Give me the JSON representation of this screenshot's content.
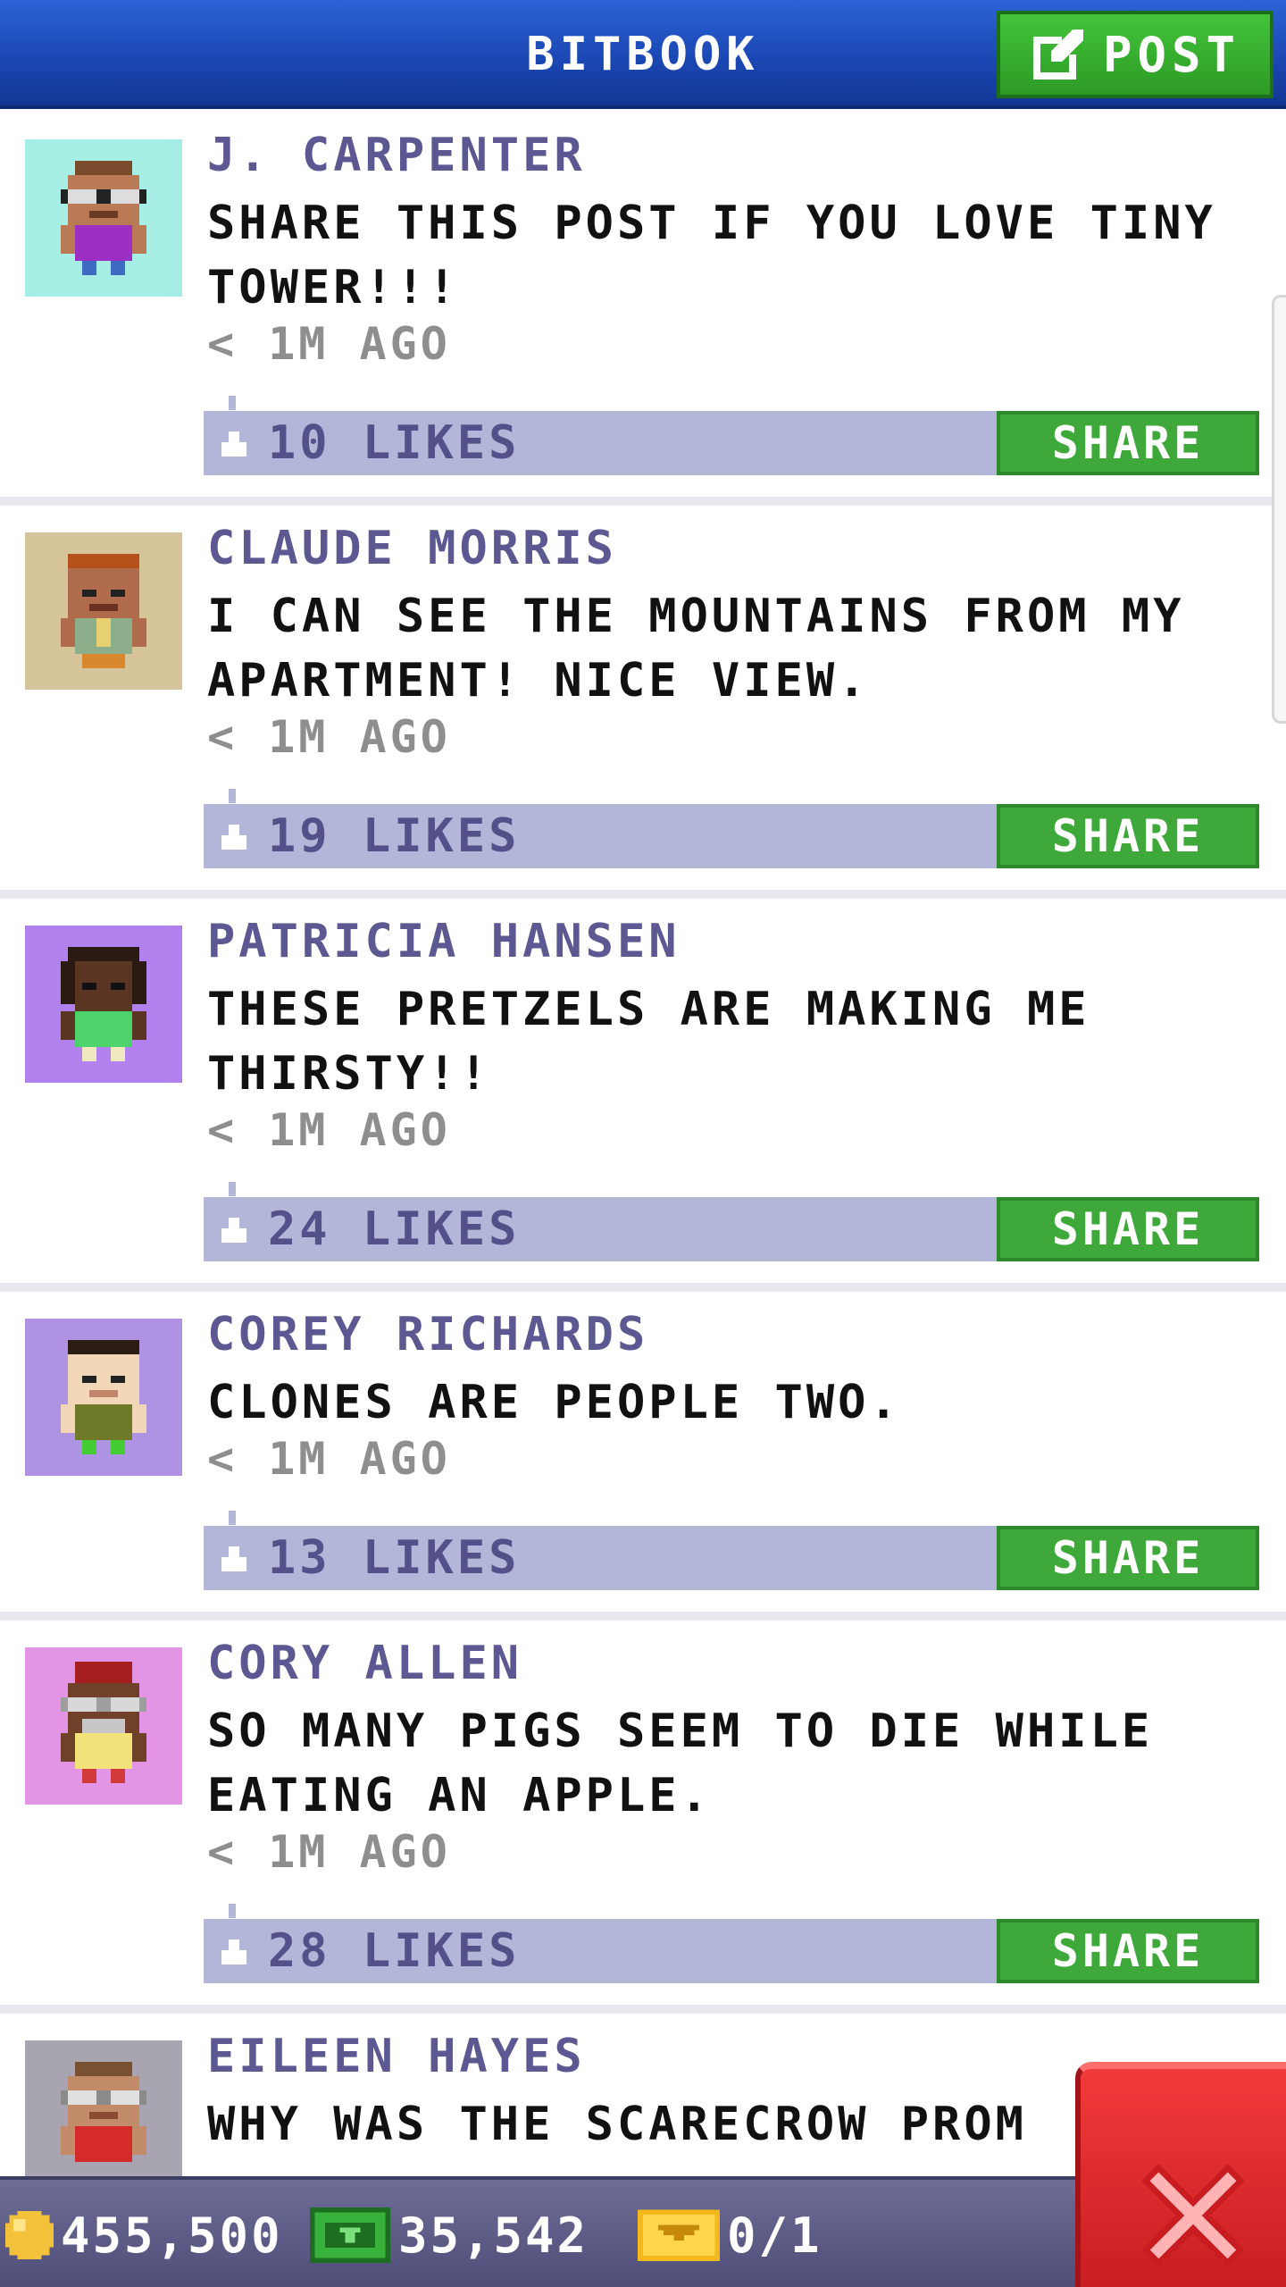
{
  "header": {
    "title": "BITBOOK",
    "post_label": "POST"
  },
  "posts": [
    {
      "name": "J. CARPENTER",
      "message": "SHARE THIS POST IF YOU LOVE TINY TOWER!!!",
      "time": "< 1M AGO",
      "likes": "10 LIKES",
      "share_label": "SHARE",
      "avatar_bg": "#a6eee3"
    },
    {
      "name": "CLAUDE MORRIS",
      "message": "I CAN SEE THE MOUNTAINS FROM MY APARTMENT! NICE VIEW.",
      "time": "< 1M AGO",
      "likes": "19 LIKES",
      "share_label": "SHARE",
      "avatar_bg": "#d6c49b"
    },
    {
      "name": "PATRICIA HANSEN",
      "message": "THESE PRETZELS ARE MAKING ME THIRSTY!!",
      "time": "< 1M AGO",
      "likes": "24 LIKES",
      "share_label": "SHARE",
      "avatar_bg": "#b182ee"
    },
    {
      "name": "COREY RICHARDS",
      "message": "CLONES ARE PEOPLE TWO.",
      "time": "< 1M AGO",
      "likes": "13 LIKES",
      "share_label": "SHARE",
      "avatar_bg": "#ad93e1"
    },
    {
      "name": "CORY ALLEN",
      "message": "SO MANY PIGS SEEM TO DIE WHILE EATING AN APPLE.",
      "time": "< 1M AGO",
      "likes": "28 LIKES",
      "share_label": "SHARE",
      "avatar_bg": "#e295e5"
    },
    {
      "name": "EILEEN HAYES",
      "message": "WHY WAS THE SCARECROW PROM",
      "avatar_bg": "#a8a5b0"
    }
  ],
  "bottom_bar": {
    "coins": "455,500",
    "bux": "35,542",
    "tickets": "0/1"
  },
  "colors": {
    "header_blue": "#1b48b4",
    "share_green": "#3fa83a",
    "likes_bar": "#b4b6d9",
    "name_purple": "#5c5891",
    "close_red": "#e02a2e"
  }
}
